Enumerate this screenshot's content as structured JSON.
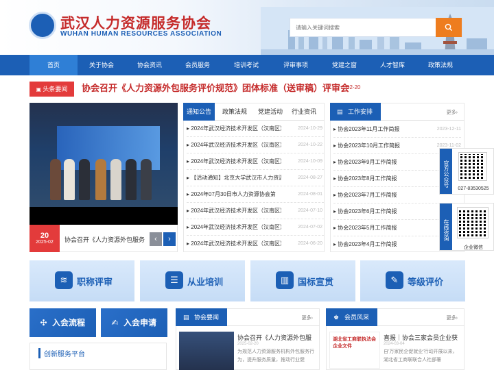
{
  "header": {
    "logo_cn": "武汉人力资源服务协会",
    "logo_en": "WUHAN HUMAN RESOURCES ASSOCIATION",
    "search_placeholder": "请输入关键词搜索"
  },
  "nav": [
    "首页",
    "关于协会",
    "协会资讯",
    "会员服务",
    "培训考试",
    "评审事项",
    "党建之窗",
    "人才智库",
    "政策法规"
  ],
  "headline": {
    "badge": "头条要闻",
    "title": "协会召开《人力资源外包服务评价规范》团体标准（送审稿）评审会",
    "date": "02-20"
  },
  "slider": {
    "day": "20",
    "year_month": "2025-02",
    "caption": "协会召开《人力资源外包服务"
  },
  "tabs": [
    "通知公告",
    "政策法规",
    "党建活动",
    "行业资讯"
  ],
  "notices": [
    {
      "title": "2024年武汉经济技术开发区（汉南区）",
      "date": "2024-10-29"
    },
    {
      "title": "2024年武汉经济技术开发区（汉南区）",
      "date": "2024-10-22"
    },
    {
      "title": "2024年武汉经济技术开发区（汉南区）",
      "date": "2024-10-09"
    },
    {
      "title": "【活动通知】北京大学武汉市人力资源",
      "date": "2024-08-27"
    },
    {
      "title": "2024年07月30日市人力资源协会第",
      "date": "2024-08-01"
    },
    {
      "title": "2024年武汉经济技术开发区（汉南区）",
      "date": "2024-07-10"
    },
    {
      "title": "2024年武汉经济技术开发区（汉南区）",
      "date": "2024-07-02"
    },
    {
      "title": "2024年武汉经济技术开发区（汉南区）",
      "date": "2024-06-20"
    }
  ],
  "work": {
    "title": "工作安排",
    "more": "更多›",
    "items": [
      {
        "title": "协会2023年11月工作简报",
        "date": "2023-12-11"
      },
      {
        "title": "协会2023年10月工作简报",
        "date": "2023-11-02"
      },
      {
        "title": "协会2023年9月工作简报",
        "date": ""
      },
      {
        "title": "协会2023年8月工作简报",
        "date": ""
      },
      {
        "title": "协会2023年7月工作简报",
        "date": ""
      },
      {
        "title": "协会2023年6月工作简报",
        "date": ""
      },
      {
        "title": "协会2023年5月工作简报",
        "date": ""
      },
      {
        "title": "协会2023年4月工作简报",
        "date": ""
      }
    ]
  },
  "float": {
    "wechat_label": "官方公众号",
    "phone": "027-83530525",
    "consult_label": "在线咨询",
    "enterprise_label": "企业微信"
  },
  "services": [
    "职称评审",
    "从业培训",
    "国标宣贯",
    "等级评价"
  ],
  "join": [
    "入会流程",
    "入会申请"
  ],
  "innovation_title": "创新服务平台",
  "assoc_news": {
    "title": "协会要闻",
    "more": "更多›",
    "item_title": "协会召开《人力资源外包服",
    "item_date": "2025-02-20",
    "item_desc": "为规范人力资源服务机构外包服务行为，提升服务质量，推动行业健"
  },
  "member": {
    "title": "会员风采",
    "more": "更多›",
    "thumb_text": "湖北省工商联执法会企业文件",
    "item_title": "喜报｜协会三家会员企业获",
    "item_date": "2024-03-04",
    "item_desc": "自'万家民企促就业'行动开展以来，湖北省工商联联合人社部署"
  },
  "colors": {
    "primary": "#1c5fb5",
    "accent": "#e33b3b",
    "search_btn": "#ee7d1f"
  }
}
